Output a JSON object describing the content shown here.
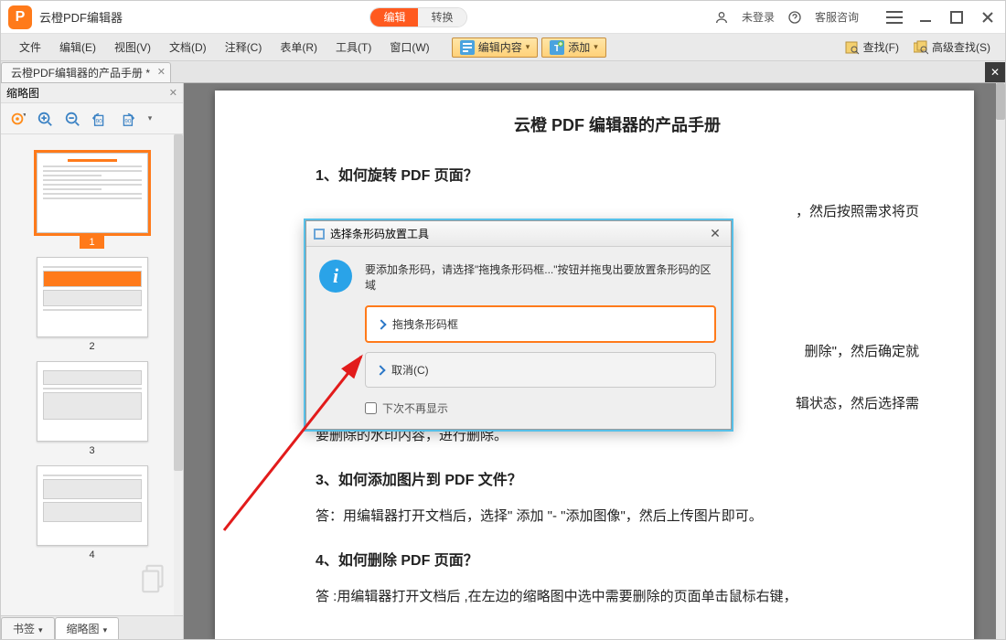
{
  "titlebar": {
    "app_name": "云橙PDF编辑器",
    "mode_edit": "编辑",
    "mode_convert": "转换",
    "login": "未登录",
    "support": "客服咨询"
  },
  "menu": {
    "file": "文件",
    "edit": "编辑(E)",
    "view": "视图(V)",
    "document": "文档(D)",
    "comment": "注释(C)",
    "form": "表单(R)",
    "tools": "工具(T)",
    "window": "窗口(W)",
    "btn_edit_content": "编辑内容",
    "btn_add": "添加",
    "search": "查找(F)",
    "adv_search": "高级查找(S)"
  },
  "doctab": {
    "name": "云橙PDF编辑器的产品手册 *"
  },
  "sidebar": {
    "title": "缩略图",
    "thumbs": [
      "1",
      "2",
      "3",
      "4"
    ],
    "tab_bookmark": "书签",
    "tab_thumb": "缩略图"
  },
  "doc": {
    "title": "云橙 PDF 编辑器的产品手册",
    "h1": "1、如何旋转  PDF  页面？",
    "p1_tail": "，然后按照需求将页",
    "p2": "删除\"，然后确定就",
    "p3a": "辑状态，然后选择需",
    "p3b": "要删除的水印内容，进行删除。",
    "h3": "3、如何添加图片到  PDF  文件？",
    "p4": "答：用编辑器打开文档后，选择\"  添加  \"- \"添加图像\"，然后上传图片即可。",
    "h4": "4、如何删除  PDF  页面？",
    "p5": "答 :用编辑器打开文档后 ,在左边的缩略图中选中需要删除的页面单击鼠标右键，"
  },
  "dialog": {
    "title": "选择条形码放置工具",
    "message": "要添加条形码，请选择\"拖拽条形码框...\"按钮并拖曳出要放置条形码的区域",
    "opt1": "拖拽条形码框",
    "opt2": "取消(C)",
    "dontshow": "下次不再显示"
  }
}
